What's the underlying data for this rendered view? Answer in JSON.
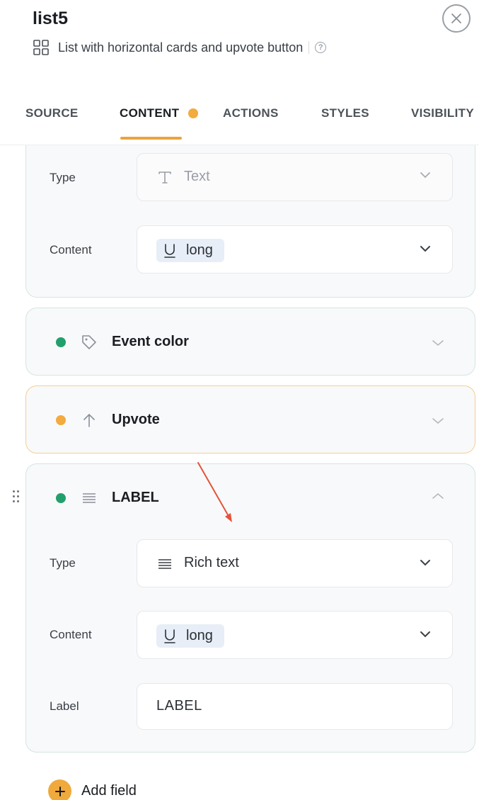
{
  "header": {
    "title": "list5",
    "subtitle": "List with horizontal cards and upvote button",
    "icons": {
      "layout": "grid-icon",
      "help": "help-icon",
      "close": "close-icon"
    }
  },
  "tabs": [
    {
      "label": "SOURCE",
      "active": false
    },
    {
      "label": "CONTENT",
      "active": true,
      "has_dot": true
    },
    {
      "label": "ACTIONS",
      "active": false
    },
    {
      "label": "STYLES",
      "active": false
    },
    {
      "label": "VISIBILITY",
      "active": false
    }
  ],
  "fields": {
    "first": {
      "type_label": "Type",
      "type_value": "Text",
      "type_icon": "text-t-icon",
      "content_label": "Content",
      "content_value": "long",
      "content_icon": "underline-icon"
    },
    "event_color": {
      "name": "Event color",
      "status": "green",
      "icon": "tag-icon"
    },
    "upvote": {
      "name": "Upvote",
      "status": "orange",
      "icon": "arrow-up-icon"
    },
    "label_field": {
      "name": "LABEL",
      "status": "green",
      "icon": "lines-icon",
      "expanded": true,
      "type_label": "Type",
      "type_value": "Rich text",
      "type_icon": "lines-icon",
      "content_label": "Content",
      "content_value": "long",
      "content_icon": "underline-icon",
      "label_label": "Label",
      "label_value": "LABEL"
    }
  },
  "add_field": {
    "label": "Add field",
    "icon": "plus-icon"
  },
  "colors": {
    "accent": "#f0a93b",
    "green_status": "#22a06b",
    "orange_status": "#f2ab3c",
    "annotation_arrow": "#e5533a"
  }
}
